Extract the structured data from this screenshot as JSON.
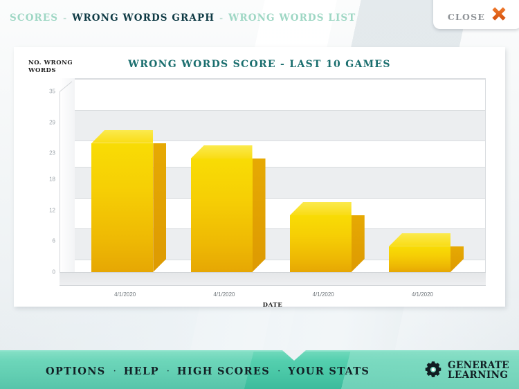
{
  "breadcrumb": {
    "items": [
      {
        "label": "SCORES",
        "active": false
      },
      {
        "label": "WRONG WORDS GRAPH",
        "active": true
      },
      {
        "label": "WRONG WORDS LIST",
        "active": false
      }
    ],
    "separator": "-"
  },
  "close": {
    "label": "CLOSE",
    "icon": "close-x-icon",
    "icon_color": "#e2621b"
  },
  "chart_data": {
    "type": "bar",
    "title": "WRONG WORDS SCORE - LAST 10 GAMES",
    "xlabel": "DATE",
    "ylabel": "NO. WRONG WORDS",
    "categories": [
      "4/1/2020",
      "4/1/2020",
      "4/1/2020",
      "4/1/2020"
    ],
    "values": [
      25,
      22,
      11,
      5
    ],
    "yticks": [
      35,
      29,
      23,
      18,
      12,
      6,
      0
    ],
    "ylim": [
      0,
      35
    ],
    "grid": true,
    "legend": "none",
    "bar_color": "#f6cf05",
    "bar_side_color": "#e0a002",
    "title_color": "#1a6e6e"
  },
  "footer": {
    "nav": [
      {
        "label": "OPTIONS"
      },
      {
        "label": "HELP"
      },
      {
        "label": "HIGH SCORES"
      },
      {
        "label": "YOUR STATS"
      }
    ],
    "separator": "·",
    "logo": {
      "line1": "GENERATE",
      "line2": "LEARNING",
      "icon": "gear-icon"
    },
    "accent_color": "#49c7a6"
  }
}
